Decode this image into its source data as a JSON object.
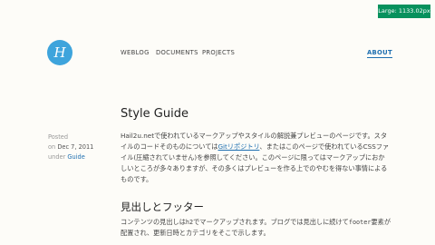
{
  "badge": {
    "label": "Large: 1133.02px"
  },
  "logo": {
    "glyph": "H"
  },
  "nav": {
    "weblog": "WEBLOG",
    "documents": "DOCUMENTS",
    "projects": "PROJECTS",
    "about": "ABOUT"
  },
  "meta": {
    "posted_label": "Posted",
    "on_label": "on",
    "date": "Dec 7, 2011",
    "under_label": "under",
    "category": "Guide"
  },
  "article": {
    "title": "Style Guide",
    "p1_part1": "Hail2u.netで使われているマークアップやスタイルの解説兼プレビューのページです。スタイルのコードそのものについては",
    "p1_link": "Gitリポジトリ",
    "p1_part2": "、またはこのページで使われているCSSファイル(圧縮されていません)を参照してください。このページに限ってはマークアップにおかしいところが多々ありますが、その多くはプレビューを作る上でのやむを得ない事情によるものです。",
    "h2": "見出しとフッター",
    "p2_part1": "コンテンツの見出しは",
    "p2_code1": "h2",
    "p2_part2": "でマークアップされます。ブログでは見出しに続けて",
    "p2_code2": "footer",
    "p2_part3": "要素が配置され、更新日時とカテゴリをそこで示します。"
  }
}
